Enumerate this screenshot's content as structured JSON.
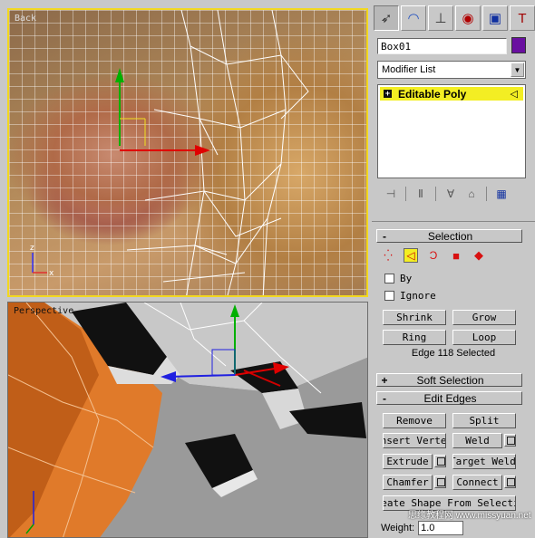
{
  "viewports": {
    "top_label": "Back",
    "bottom_label": "Perspective"
  },
  "panel": {
    "tabs": [
      {
        "icon": "cursor-icon"
      },
      {
        "icon": "modify-arc-icon"
      },
      {
        "icon": "hierarchy-icon"
      },
      {
        "icon": "motion-icon"
      },
      {
        "icon": "display-icon"
      },
      {
        "icon": "utilities-hammer-icon"
      }
    ],
    "object_name": "Box01",
    "object_color": "#6a0fa0",
    "modifier_list": "Modifier List",
    "stack": {
      "item": "Editable Poly"
    },
    "selection": {
      "title": "Selection",
      "by_label": "By",
      "ignore_label": "Ignore",
      "shrink": "Shrink",
      "grow": "Grow",
      "ring": "Ring",
      "loop": "Loop",
      "status": "Edge 118 Selected"
    },
    "soft_selection": {
      "title": "Soft Selection"
    },
    "edit_edges": {
      "title": "Edit Edges",
      "remove": "Remove",
      "split": "Split",
      "insert_vertex": "Insert Vertex",
      "weld": "Weld",
      "extrude": "Extrude",
      "target_weld": "Target Weld",
      "chamfer": "Chamfer",
      "connect": "Connect",
      "create_shape": "Create Shape From Selection",
      "weight_label": "Weight:",
      "weight_value": "1.0"
    }
  },
  "watermark": "思缘教程网 www.missyuan.net"
}
